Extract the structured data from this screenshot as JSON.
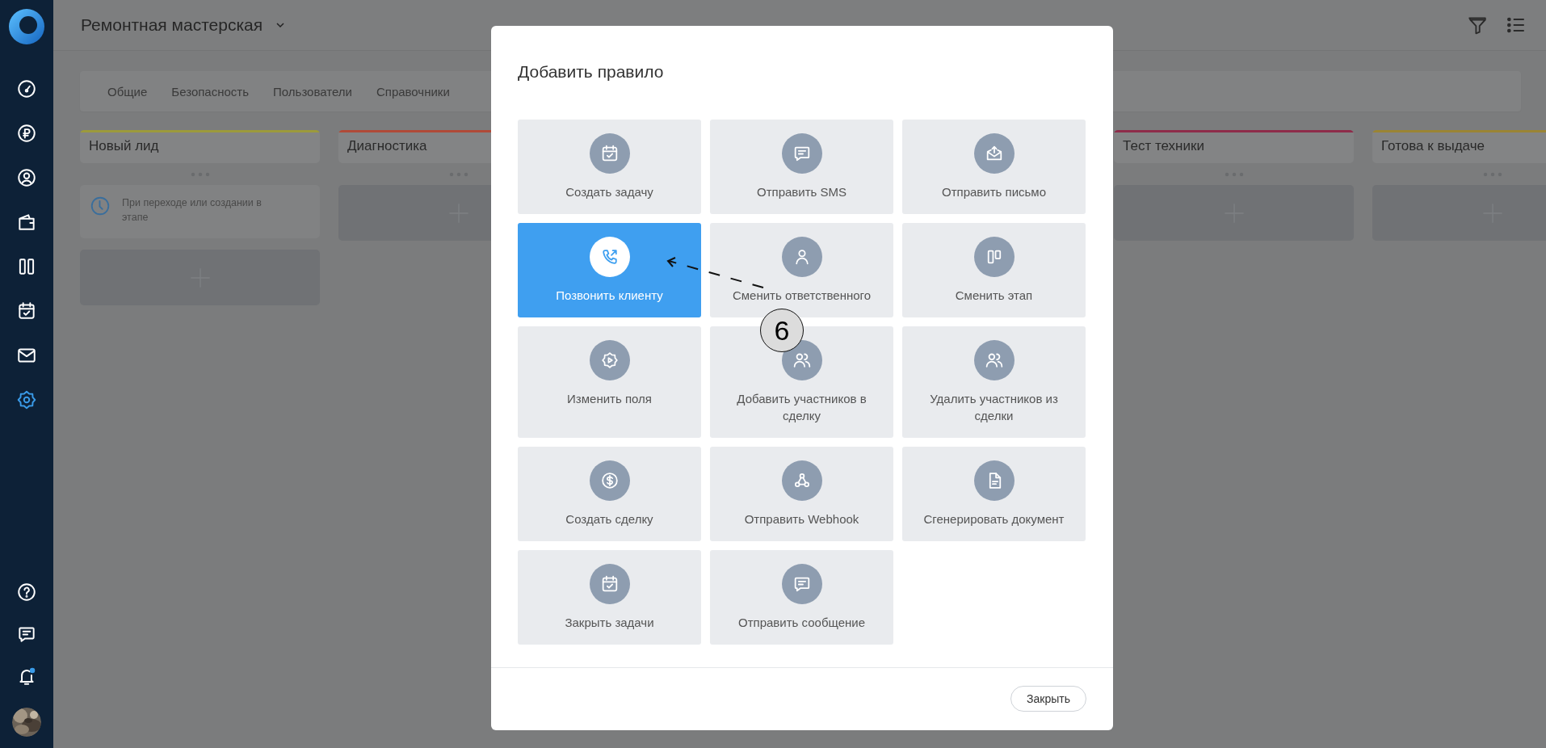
{
  "sidebar": {
    "items": [
      {
        "selected": false
      },
      {
        "selected": false
      },
      {
        "selected": false
      },
      {
        "selected": false
      },
      {
        "selected": false
      },
      {
        "selected": false
      },
      {
        "selected": false
      },
      {
        "selected": true
      }
    ],
    "bottom_items": [
      {
        "dot": false
      },
      {
        "dot": false
      },
      {
        "dot": true
      }
    ]
  },
  "header": {
    "title": "Ремонтная мастерская"
  },
  "tabs": [
    {
      "label": "Общие"
    },
    {
      "label": "Безопасность"
    },
    {
      "label": "Пользователи"
    },
    {
      "label": "Справочники"
    }
  ],
  "columns": [
    {
      "title": "Новый лид",
      "color": "#9c9a3c",
      "cards": [
        {
          "text": "При переходе или создании в этапе"
        }
      ]
    },
    {
      "title": "Диагностика",
      "color": "#b04a38"
    },
    {
      "title": "Тест техники",
      "color": "#8e2c4a"
    },
    {
      "title": "Готова к выдаче",
      "color": "#9a8434"
    }
  ],
  "dialog": {
    "title": "Добавить правило",
    "actions": [
      {
        "label": "Создать задачу",
        "selected": false
      },
      {
        "label": "Отправить SMS",
        "selected": false
      },
      {
        "label": "Отправить письмо",
        "selected": false
      },
      {
        "label": "Позвонить клиенту",
        "selected": true
      },
      {
        "label": "Сменить ответственного",
        "selected": false
      },
      {
        "label": "Сменить этап",
        "selected": false
      },
      {
        "label": "Изменить поля",
        "selected": false
      },
      {
        "label": "Добавить участников в сделку",
        "selected": false
      },
      {
        "label": "Удалить участников из сделки",
        "selected": false
      },
      {
        "label": "Создать сделку",
        "selected": false
      },
      {
        "label": "Отправить Webhook",
        "selected": false
      },
      {
        "label": "Сгенерировать документ",
        "selected": false
      },
      {
        "label": "Закрыть задачи",
        "selected": false
      },
      {
        "label": "Отправить сообщение",
        "selected": false
      }
    ],
    "buttons": [
      "Закрыть"
    ]
  },
  "annotation": {
    "label": "6"
  }
}
